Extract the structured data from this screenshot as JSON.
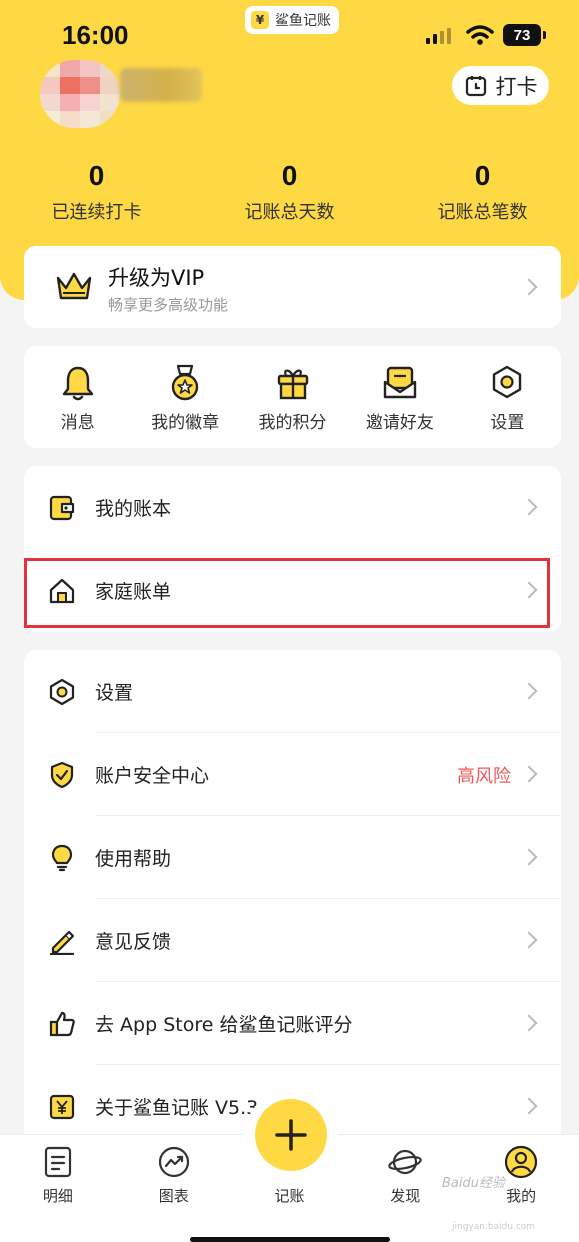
{
  "status_bar": {
    "time": "16:00",
    "app_name": "鲨鱼记账",
    "app_badge": "¥",
    "battery": "73"
  },
  "header": {
    "checkin_label": "打卡"
  },
  "stats": [
    {
      "value": "0",
      "label": "已连续打卡"
    },
    {
      "value": "0",
      "label": "记账总天数"
    },
    {
      "value": "0",
      "label": "记账总笔数"
    }
  ],
  "vip": {
    "title": "升级为VIP",
    "subtitle": "畅享更多高级功能"
  },
  "quick_actions": [
    {
      "label": "消息",
      "icon": "bell-icon"
    },
    {
      "label": "我的徽章",
      "icon": "medal-icon"
    },
    {
      "label": "我的积分",
      "icon": "gift-icon"
    },
    {
      "label": "邀请好友",
      "icon": "envelope-icon"
    },
    {
      "label": "设置",
      "icon": "settings-icon"
    }
  ],
  "menu_books": [
    {
      "label": "我的账本",
      "icon": "wallet-icon"
    },
    {
      "label": "家庭账单",
      "icon": "home-icon"
    }
  ],
  "menu_settings": [
    {
      "label": "设置",
      "icon": "settings-icon"
    },
    {
      "label": "账户安全中心",
      "icon": "shield-icon",
      "extra": "高风险"
    },
    {
      "label": "使用帮助",
      "icon": "lightbulb-icon"
    },
    {
      "label": "意见反馈",
      "icon": "pencil-icon"
    },
    {
      "label": "去 App Store 给鲨鱼记账评分",
      "icon": "thumbs-up-icon"
    },
    {
      "label": "关于鲨鱼记账 V5.3",
      "icon": "yen-icon"
    }
  ],
  "tabbar": [
    {
      "label": "明细",
      "icon": "document-icon"
    },
    {
      "label": "图表",
      "icon": "chart-icon"
    },
    {
      "label": "记账",
      "icon": "plus-icon"
    },
    {
      "label": "发现",
      "icon": "planet-icon"
    },
    {
      "label": "我的",
      "icon": "user-icon"
    }
  ],
  "watermark": {
    "text": "Baidu经验",
    "url": "jingyan.baidu.com"
  },
  "colors": {
    "brand_yellow": "#ffd944",
    "danger": "#f05a5a",
    "highlight_border": "#e5333b"
  }
}
